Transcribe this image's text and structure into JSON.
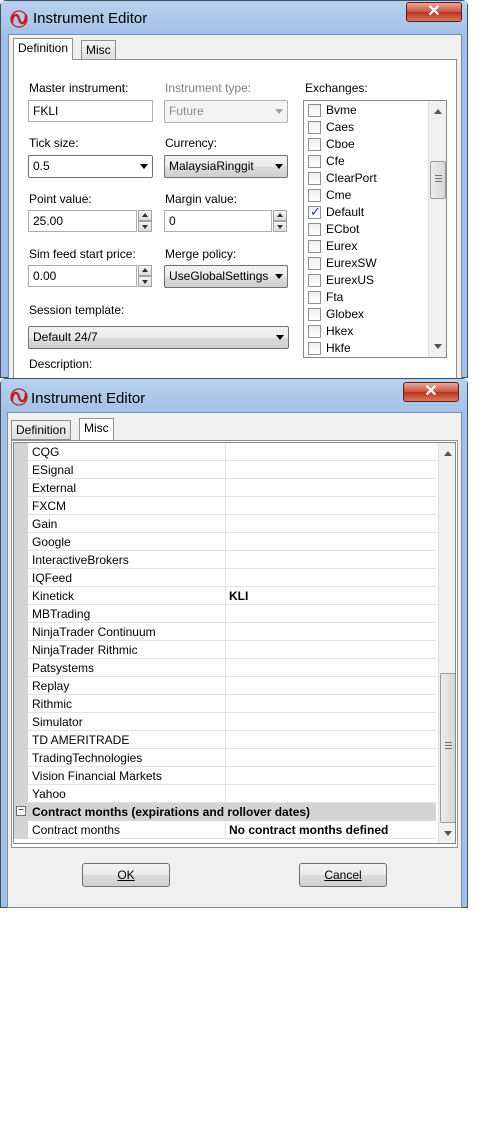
{
  "window1": {
    "title": "Instrument Editor",
    "close_glyph": "✕",
    "tabs": [
      {
        "label": "Definition",
        "active": true
      },
      {
        "label": "Misc",
        "active": false
      }
    ],
    "fields": {
      "master_instrument_label": "Master instrument:",
      "master_instrument_value": "FKLI",
      "instrument_type_label": "Instrument type:",
      "instrument_type_value": "Future",
      "tick_size_label": "Tick size:",
      "tick_size_value": "0.5",
      "currency_label": "Currency:",
      "currency_value": "MalaysiaRinggit",
      "point_value_label": "Point value:",
      "point_value_value": "25.00",
      "margin_value_label": "Margin value:",
      "margin_value_value": "0",
      "sim_feed_label": "Sim feed start price:",
      "sim_feed_value": "0.00",
      "merge_policy_label": "Merge policy:",
      "merge_policy_value": "UseGlobalSettings",
      "session_template_label": "Session template:",
      "session_template_value": "Default 24/7",
      "description_label": "Description:"
    },
    "exchanges_label": "Exchanges:",
    "exchanges": [
      {
        "name": "Bvme",
        "checked": false
      },
      {
        "name": "Caes",
        "checked": false
      },
      {
        "name": "Cboe",
        "checked": false
      },
      {
        "name": "Cfe",
        "checked": false
      },
      {
        "name": "ClearPort",
        "checked": false
      },
      {
        "name": "Cme",
        "checked": false
      },
      {
        "name": "Default",
        "checked": true
      },
      {
        "name": "ECbot",
        "checked": false
      },
      {
        "name": "Eurex",
        "checked": false
      },
      {
        "name": "EurexSW",
        "checked": false
      },
      {
        "name": "EurexUS",
        "checked": false
      },
      {
        "name": "Fta",
        "checked": false
      },
      {
        "name": "Globex",
        "checked": false
      },
      {
        "name": "Hkex",
        "checked": false
      },
      {
        "name": "Hkfe",
        "checked": false
      }
    ]
  },
  "window2": {
    "title": "Instrument Editor",
    "close_glyph": "✕",
    "tabs": [
      {
        "label": "Definition",
        "active": false
      },
      {
        "label": "Misc",
        "active": true
      }
    ],
    "providers": [
      {
        "name": "CQG",
        "value": ""
      },
      {
        "name": "ESignal",
        "value": ""
      },
      {
        "name": "External",
        "value": ""
      },
      {
        "name": "FXCM",
        "value": ""
      },
      {
        "name": "Gain",
        "value": ""
      },
      {
        "name": "Google",
        "value": ""
      },
      {
        "name": "InteractiveBrokers",
        "value": ""
      },
      {
        "name": "IQFeed",
        "value": ""
      },
      {
        "name": "Kinetick",
        "value": "KLI"
      },
      {
        "name": "MBTrading",
        "value": ""
      },
      {
        "name": "NinjaTrader Continuum",
        "value": ""
      },
      {
        "name": "NinjaTrader Rithmic",
        "value": ""
      },
      {
        "name": "Patsystems",
        "value": ""
      },
      {
        "name": "Replay",
        "value": ""
      },
      {
        "name": "Rithmic",
        "value": ""
      },
      {
        "name": "Simulator",
        "value": ""
      },
      {
        "name": "TD AMERITRADE",
        "value": ""
      },
      {
        "name": "TradingTechnologies",
        "value": ""
      },
      {
        "name": "Vision Financial Markets",
        "value": ""
      },
      {
        "name": "Yahoo",
        "value": ""
      }
    ],
    "category": {
      "toggle": "−",
      "title": "Contract months (expirations and rollover dates)"
    },
    "contract_row": {
      "name": "Contract months",
      "value": "No contract months defined"
    },
    "ok_label": "OK",
    "cancel_label": "Cancel"
  },
  "icons": {
    "app": "ninjatrader-logo-icon",
    "close": "close-icon"
  },
  "colors": {
    "frame": "#9fc0e3",
    "close_button": "#c7533e",
    "client": "#f0f0f0"
  }
}
